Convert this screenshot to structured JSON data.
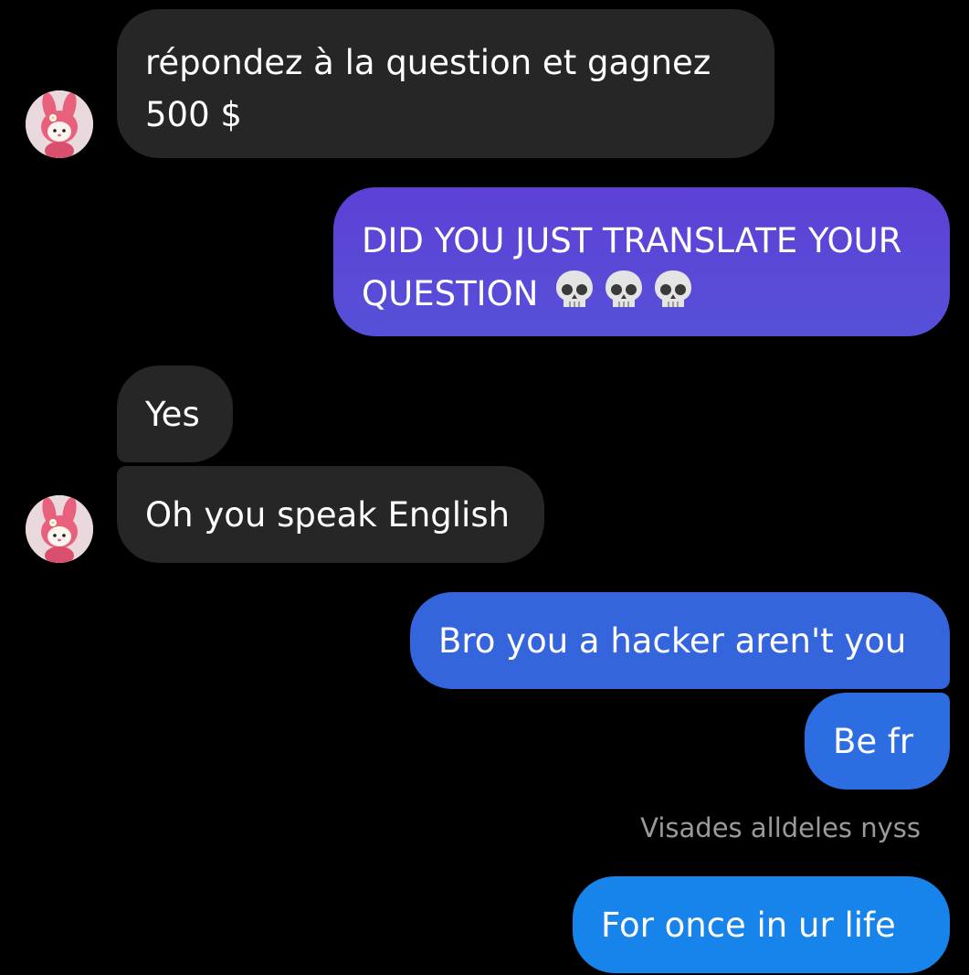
{
  "conversation": {
    "messages": [
      {
        "sender": "other",
        "lines": [
          "répondez à la question et gagnez",
          "500 $"
        ]
      },
      {
        "sender": "me",
        "lines": [
          "DID YOU JUST TRANSLATE YOUR",
          "QUESTION"
        ],
        "trailing_emoji": "skull-icon x3"
      },
      {
        "sender": "other",
        "text": "Yes"
      },
      {
        "sender": "other",
        "text": "Oh you speak English"
      },
      {
        "sender": "me",
        "text": "Bro you a hacker aren't you"
      },
      {
        "sender": "me",
        "text": "Be fr"
      },
      {
        "sender": "me",
        "text": "For once in ur life"
      }
    ],
    "seen_status": "Visades alldeles nyss"
  },
  "colors": {
    "background": "#000000",
    "incoming_bubble": "#262626",
    "outgoing_purple": "#5c42d4",
    "outgoing_blue": "#2f6ae0",
    "outgoing_light_blue": "#1a86ee",
    "seen_text": "#9a9a9a"
  }
}
